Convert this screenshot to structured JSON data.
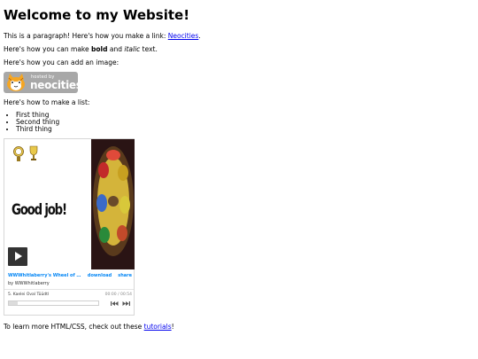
{
  "heading": "Welcome to my Website!",
  "para1": {
    "text": "This is a paragraph! Here's how you make a link: ",
    "link": "Neocities",
    "end": "."
  },
  "para2": {
    "pre": "Here's how you can make ",
    "bold": "bold",
    "mid": " and ",
    "italic": "italic",
    "post": " text."
  },
  "para3": "Here's how you can add an image:",
  "badge": {
    "hosted": "hosted by",
    "brand": "neocities"
  },
  "para4": "Here's how to make a list:",
  "list": [
    "First thing",
    "Second thing",
    "Third thing"
  ],
  "player": {
    "cover_text": "Good job!",
    "track_title": "WWWhitlaberry's Wheel of the ...",
    "download_label": "download",
    "share_label": "share",
    "artist": "by WWWhitlaberry",
    "current_track": "5. Kaelei Oval Tüüdtl",
    "time": "00:00 / 00:54",
    "progress": 0.1,
    "accent": "#0687f5"
  },
  "closing": {
    "text": "To learn more HTML/CSS, check out these ",
    "link": "tutorials",
    "end": "!"
  }
}
